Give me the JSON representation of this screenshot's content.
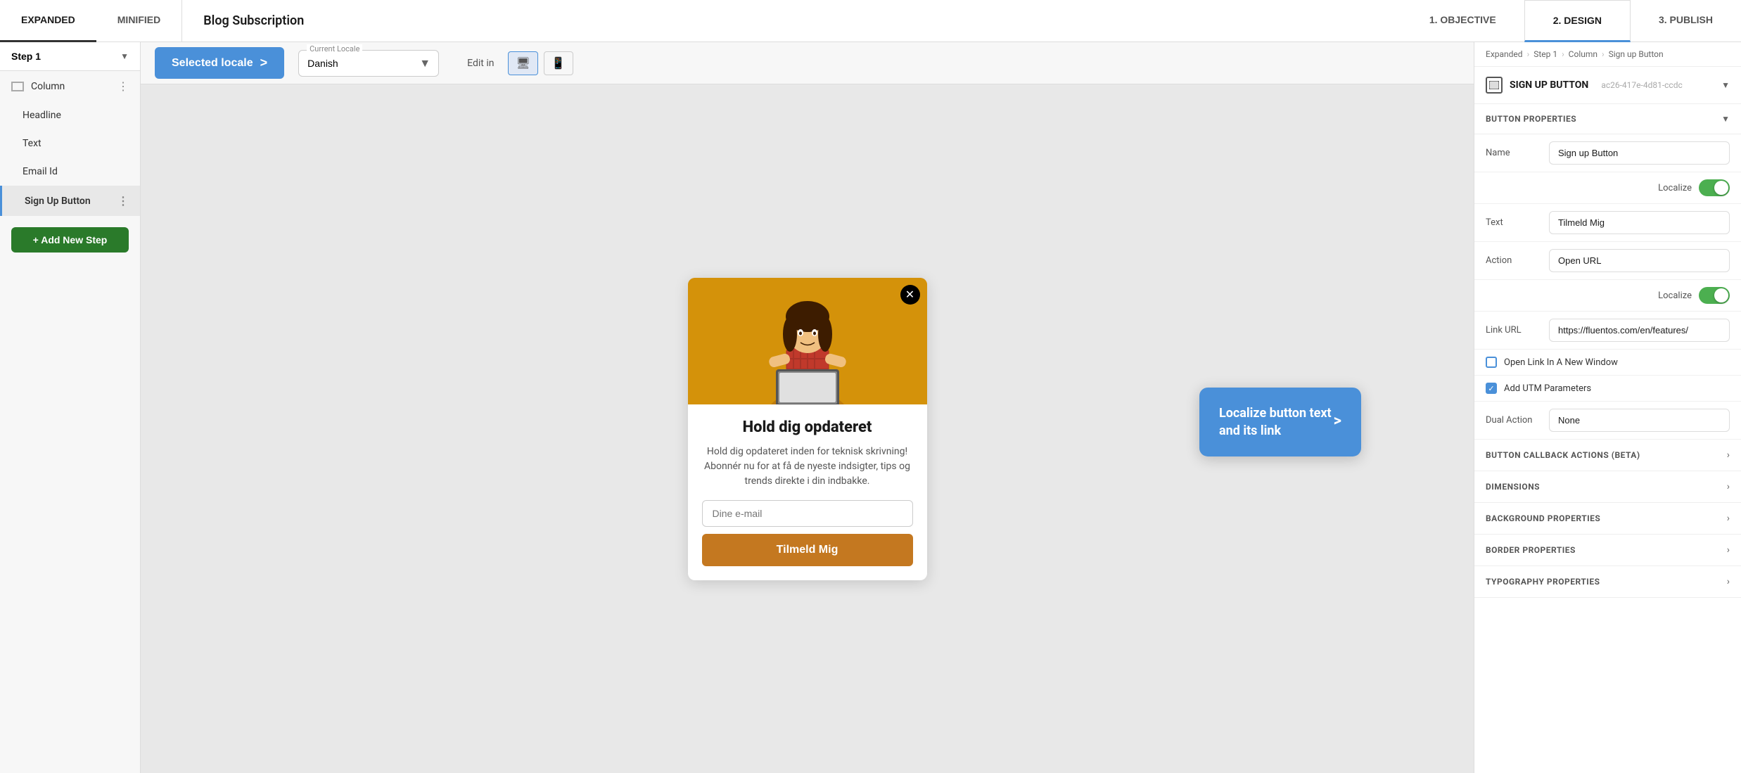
{
  "topBar": {
    "tabs": [
      {
        "id": "expanded",
        "label": "EXPANDED",
        "active": true
      },
      {
        "id": "minified",
        "label": "MINIFIED",
        "active": false
      }
    ],
    "pageTitle": "Blog Subscription",
    "rightTabs": [
      {
        "id": "objective",
        "label": "1. OBJECTIVE"
      },
      {
        "id": "design",
        "label": "2. DESIGN",
        "active": true
      },
      {
        "id": "publish",
        "label": "3. PUBLISH"
      }
    ]
  },
  "sidebar": {
    "stepLabel": "Step 1",
    "items": [
      {
        "id": "column",
        "label": "Column",
        "type": "column",
        "hasIcon": true
      },
      {
        "id": "headline",
        "label": "Headline",
        "indent": true
      },
      {
        "id": "text",
        "label": "Text",
        "indent": true
      },
      {
        "id": "email-id",
        "label": "Email Id",
        "indent": true
      },
      {
        "id": "sign-up-button",
        "label": "Sign Up Button",
        "indent": true,
        "selected": true
      }
    ],
    "addStepLabel": "+ Add New Step"
  },
  "canvas": {
    "localeBtn": "Selected locale",
    "localeArrow": ">",
    "currentLocaleLabel": "Current Locale",
    "currentLocaleValue": "Danish",
    "editInLabel": "Edit in",
    "modal": {
      "title": "Hold dig opdateret",
      "description": "Hold dig opdateret inden for teknisk skrivning! Abonnér nu for at få de nyeste indsigter, tips og trends direkte i din indbakke.",
      "inputPlaceholder": "Dine e-mail",
      "submitLabel": "Tilmeld Mig"
    },
    "tooltip": {
      "text": "Localize button text and its link",
      "arrow": ">"
    }
  },
  "rightPanel": {
    "breadcrumb": [
      "Expanded",
      "Step 1",
      "Column",
      "Sign up Button"
    ],
    "componentType": "SIGN UP BUTTON",
    "componentId": "ac26-417e-4d81-ccdc",
    "sections": {
      "buttonProperties": "BUTTON PROPERTIES",
      "buttonCallbackActions": "BUTTON CALLBACK ACTIONS (BETA)",
      "dimensions": "DIMENSIONS",
      "backgroundProperties": "BACKGROUND PROPERTIES",
      "borderProperties": "BORDER PROPERTIES",
      "typographyProperties": "TYPOGRAPHY PROPERTIES"
    },
    "properties": {
      "nameLabel": "Name",
      "nameValue": "Sign up Button",
      "localize1Label": "Localize",
      "textLabel": "Text",
      "textValue": "Tilmeld Mig",
      "actionLabel": "Action",
      "actionValue": "Open URL",
      "localize2Label": "Localize",
      "linkUrlLabel": "Link URL",
      "linkUrlValue": "https://fluentos.com/en/features/",
      "openLinkLabel": "Open Link In A New Window",
      "addUtmLabel": "Add UTM Parameters",
      "dualActionLabel": "Dual Action",
      "dualActionValue": "None"
    }
  }
}
